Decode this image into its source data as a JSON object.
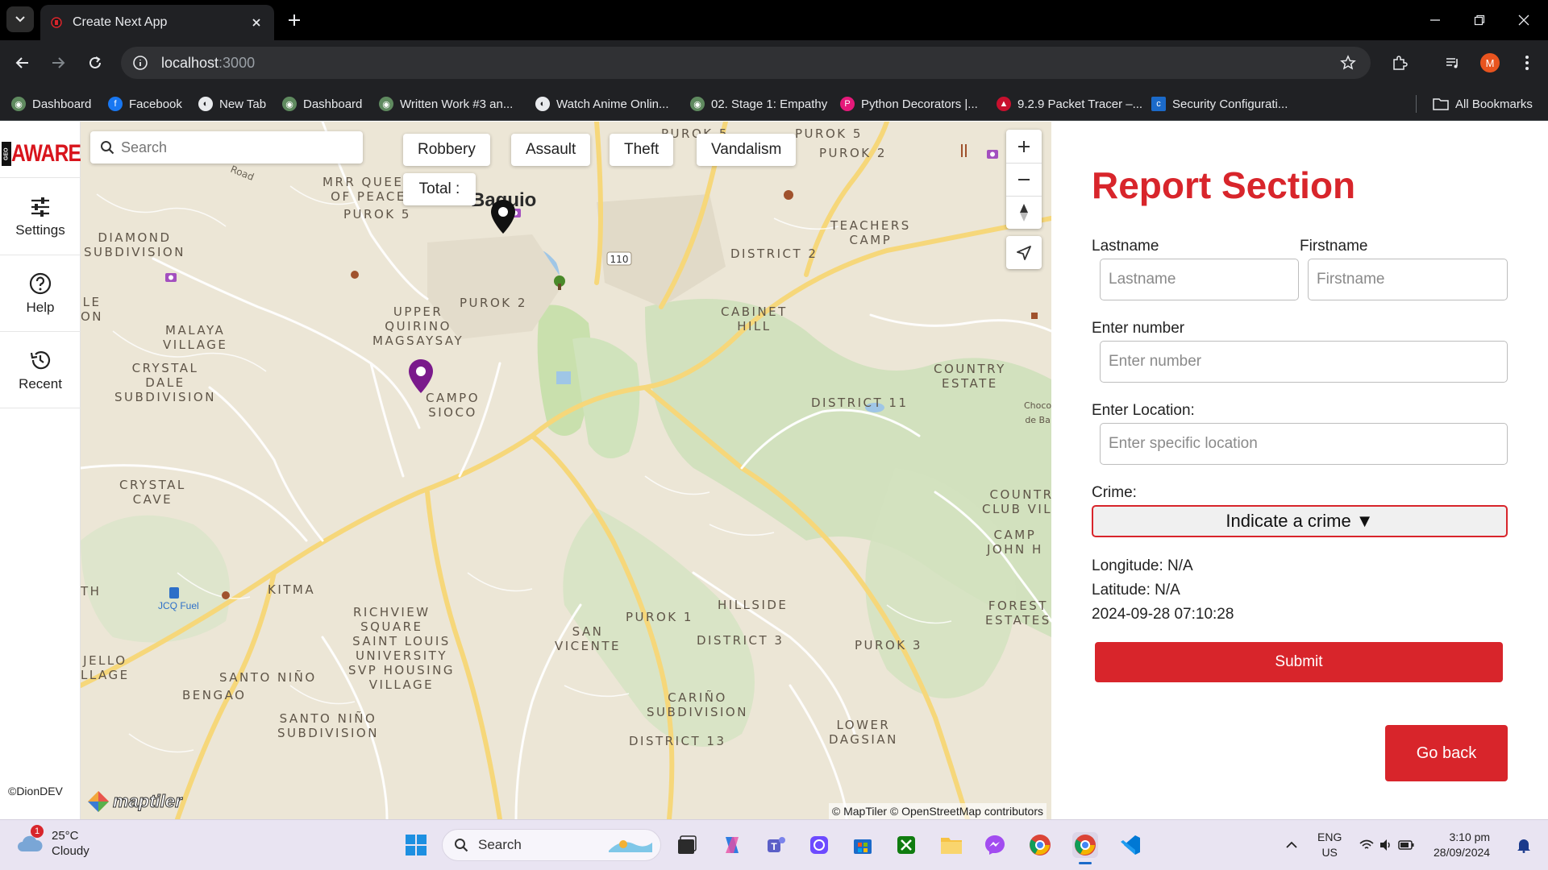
{
  "browser": {
    "tab_title": "Create Next App",
    "url_host": "localhost",
    "url_port": ":3000",
    "profile_initial": "M",
    "bookmarks": [
      {
        "label": "Dashboard",
        "color": "#5f8a5f"
      },
      {
        "label": "Facebook",
        "color": "#1877f2"
      },
      {
        "label": "New Tab",
        "color": "#e8eaed"
      },
      {
        "label": "Dashboard",
        "color": "#5f8a5f"
      },
      {
        "label": "Written Work #3 an...",
        "color": "#5f8a5f"
      },
      {
        "label": "Watch Anime Onlin...",
        "color": "#e8eaed"
      },
      {
        "label": "02. Stage 1: Empathy",
        "color": "#5f8a5f"
      },
      {
        "label": "Python Decorators |...",
        "color": "#e5197a"
      },
      {
        "label": "9.2.9 Packet Tracer –...",
        "color": "#c8102e"
      },
      {
        "label": "Security Configurati...",
        "color": "#1b6ac9"
      }
    ],
    "all_bookmarks_label": "All Bookmarks"
  },
  "sidebar": {
    "logo_geo": "GEO",
    "logo_text": "AWARE",
    "items": [
      {
        "label": "Settings",
        "icon": "sliders-icon"
      },
      {
        "label": "Help",
        "icon": "help-circle-icon"
      },
      {
        "label": "Recent",
        "icon": "history-icon"
      }
    ],
    "credit": "©DionDEV"
  },
  "map": {
    "search_placeholder": "Search",
    "filters": [
      "Robbery",
      "Assault",
      "Theft",
      "Vandalism"
    ],
    "total_label": "Total :",
    "attribution": "© MapTiler © OpenStreetMap contributors",
    "brand": "maptiler",
    "road_label": "Road",
    "road_badge": "110",
    "poi_label": "JCQ Fuel",
    "city_label": "Baguio",
    "places": [
      "MRR QUEEN\nOF PEACE",
      "PUROK 5",
      "DIAMOND\nSUBDIVISION",
      "LE\nON",
      "MALAYA\nVILLAGE",
      "CRYSTAL\nDALE\nSUBDIVISION",
      "UPPER\nQUIRINO\nMAGSAYSAY",
      "CAMPO\nSIOCO",
      "CRYSTAL\nCAVE",
      "KITMA",
      "TH",
      "RICHVIEW\nSQUARE",
      "JELLO\nLLAGE",
      "SANTO NIÑO",
      "BENGAO",
      "SAINT LOUIS\nUNIVERSITY\nSVP HOUSING\nVILLAGE",
      "SANTO NIÑO\nSUBDIVISION",
      "SAN\nVICENTE",
      "PUROK 1",
      "HILLSIDE",
      "DISTRICT 3",
      "CARIÑO\nSUBDIVISION",
      "LOWER\nDAGSIAN",
      "PUROK 3",
      "DISTRICT 13",
      "PUROK 2",
      "DISTRICT 2",
      "CABINET\nHILL",
      "TEACHERS\nCAMP",
      "PUROK 5",
      "PUROK 2",
      "DISTRICT 11",
      "COUNTRY\nESTATE",
      "COUNTR\nCLUB VILL",
      "CAMP\nJOHN H",
      "FOREST\nESTATES",
      "Choco\nde Ba",
      "PUROK 5"
    ]
  },
  "report": {
    "title": "Report Section",
    "lastname_label": "Lastname",
    "lastname_placeholder": "Lastname",
    "firstname_label": "Firstname",
    "firstname_placeholder": "Firstname",
    "number_label": "Enter number",
    "number_placeholder": "Enter number",
    "location_label": "Enter Location:",
    "location_placeholder": "Enter specific location",
    "crime_label": "Crime:",
    "crime_select": "Indicate a crime ▼",
    "longitude": "Longitude: N/A",
    "latitude": "Latitude: N/A",
    "timestamp": "2024-09-28 07:10:28",
    "submit_label": "Submit",
    "goback_label": "Go back"
  },
  "taskbar": {
    "weather_badge": "1",
    "temperature": "25°C",
    "condition": "Cloudy",
    "search_label": "Search",
    "lang": "ENG",
    "region": "US",
    "time": "3:10 pm",
    "date": "28/09/2024"
  },
  "colors": {
    "accent_red": "#d8252b",
    "chrome_dark": "#202124",
    "map_bg": "#ece6d6",
    "marker_purple": "#7a1a8c"
  }
}
